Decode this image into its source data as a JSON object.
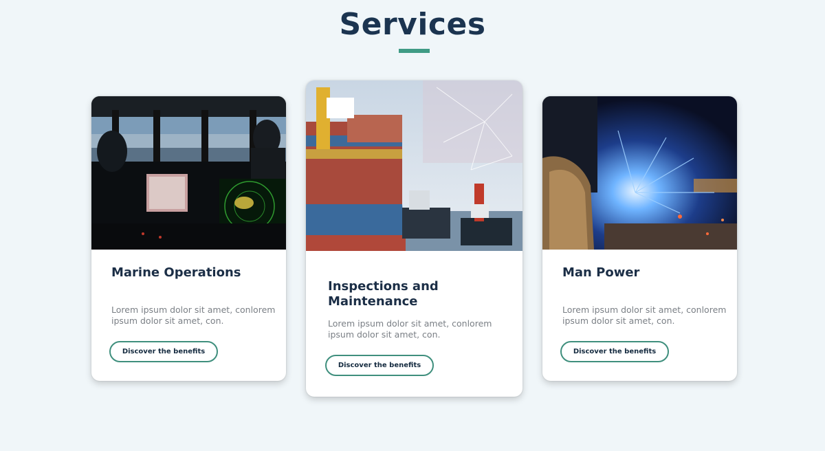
{
  "section": {
    "title": "Services"
  },
  "cards": [
    {
      "title": "Marine Operations",
      "description": "Lorem ipsum dolor sit amet, conlorem ipsum dolor sit amet, con.",
      "button_label": "Discover the benefits"
    },
    {
      "title": "Inspections and Maintenance",
      "description": "Lorem ipsum dolor sit amet, conlorem ipsum dolor sit amet, con.",
      "button_label": "Discover the benefits"
    },
    {
      "title": "Man Power",
      "description": "Lorem ipsum dolor sit amet, conlorem ipsum dolor sit amet, con.",
      "button_label": "Discover the benefits"
    }
  ],
  "colors": {
    "background": "#f0f6f9",
    "title": "#1b3450",
    "accent": "#3f9b85",
    "button_border": "#3f8f7d"
  }
}
